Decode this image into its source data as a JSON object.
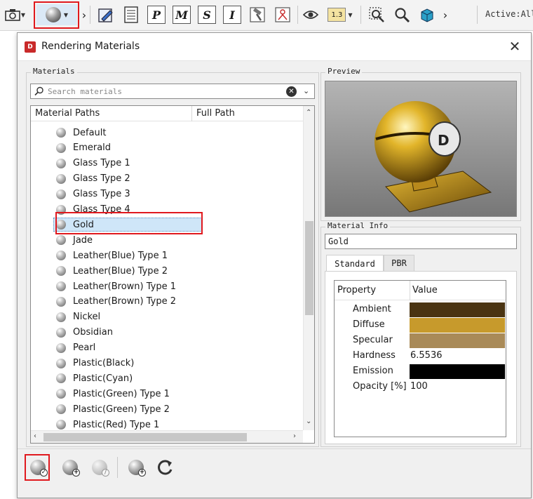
{
  "toolbar": {
    "items": [
      {
        "name": "camera-icon",
        "label": "📷"
      },
      {
        "name": "material-sphere-icon",
        "label": "●"
      },
      {
        "name": "edit-icon",
        "label": ""
      },
      {
        "name": "list-icon",
        "label": ""
      },
      {
        "name": "p-button",
        "label": "P"
      },
      {
        "name": "m-button",
        "label": "M"
      },
      {
        "name": "s-button",
        "label": "S"
      },
      {
        "name": "i-button",
        "label": "I"
      },
      {
        "name": "hammer-icon",
        "label": ""
      },
      {
        "name": "person-icon",
        "label": ""
      },
      {
        "name": "eye-icon",
        "label": ""
      },
      {
        "name": "scale-label",
        "label": "1.3"
      },
      {
        "name": "zoom-box-icon",
        "label": ""
      },
      {
        "name": "magnifier-icon",
        "label": ""
      },
      {
        "name": "cube-icon",
        "label": ""
      }
    ],
    "active_label": "Active:All"
  },
  "dialog": {
    "title": "Rendering Materials",
    "close_glyph": "✕",
    "materials_group_label": "Materials",
    "search_placeholder": "Search materials",
    "tree_headers": [
      "Material Paths",
      "Full Path"
    ],
    "materials": [
      "Default",
      "Emerald",
      "Glass Type 1",
      "Glass Type 2",
      "Glass Type 3",
      "Glass Type 4",
      "Gold",
      "Jade",
      "Leather(Blue) Type 1",
      "Leather(Blue) Type 2",
      "Leather(Brown) Type 1",
      "Leather(Brown) Type 2",
      "Nickel",
      "Obsidian",
      "Pearl",
      "Plastic(Black)",
      "Plastic(Cyan)",
      "Plastic(Green) Type 1",
      "Plastic(Green) Type 2",
      "Plastic(Red) Type 1"
    ],
    "selected_material": "Gold",
    "preview_label": "Preview",
    "material_info_label": "Material Info",
    "material_info_value": "Gold",
    "tabs": [
      "Standard",
      "PBR"
    ],
    "active_tab": "Standard",
    "property_headers": [
      "Property",
      "Value"
    ],
    "properties": [
      {
        "name": "Ambient",
        "color": "#4a3412"
      },
      {
        "name": "Diffuse",
        "color": "#c79a2c"
      },
      {
        "name": "Specular",
        "color": "#a98a58"
      },
      {
        "name": "Hardness",
        "value": "6.5536"
      },
      {
        "name": "Emission",
        "color": "#000000"
      },
      {
        "name": "Opacity [%]",
        "value": "100"
      }
    ],
    "bottom_buttons": [
      {
        "name": "apply-material-button",
        "badge": "✓"
      },
      {
        "name": "new-material-button",
        "badge": "+"
      },
      {
        "name": "edit-material-button",
        "badge": "/"
      },
      {
        "name": "add-material-button",
        "badge": "+"
      },
      {
        "name": "refresh-button",
        "badge": ""
      }
    ]
  }
}
